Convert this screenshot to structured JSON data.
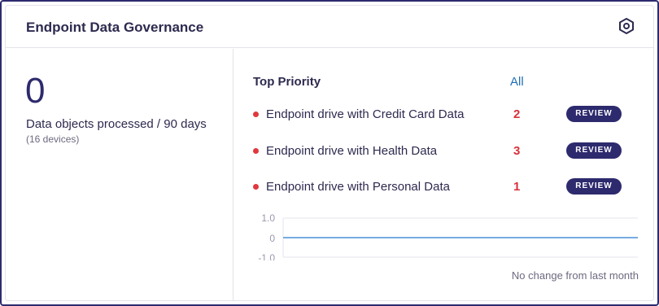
{
  "widget": {
    "title": "Endpoint Data Governance",
    "settings_icon": "settings-hex-icon"
  },
  "summary": {
    "count": "0",
    "label": "Data objects processed / 90 days",
    "sublabel": "(16 devices)"
  },
  "priority": {
    "title": "Top Priority",
    "all_link": "All",
    "items": [
      {
        "label": "Endpoint drive with Credit Card Data",
        "count": "2",
        "action": "REVIEW"
      },
      {
        "label": "Endpoint drive with Health Data",
        "count": "3",
        "action": "REVIEW"
      },
      {
        "label": "Endpoint drive with Personal Data",
        "count": "1",
        "action": "REVIEW"
      }
    ]
  },
  "trend": {
    "y_ticks": [
      "1.0",
      "0",
      "-1.0"
    ],
    "values": [
      0,
      0,
      0,
      0,
      0,
      0,
      0,
      0
    ],
    "ylim": [
      -1,
      1
    ],
    "note": "No change from last month",
    "line_color": "#4a8fd6"
  },
  "colors": {
    "accent": "#2d2a6e",
    "alert": "#e0383e",
    "link": "#1f6fb5"
  }
}
